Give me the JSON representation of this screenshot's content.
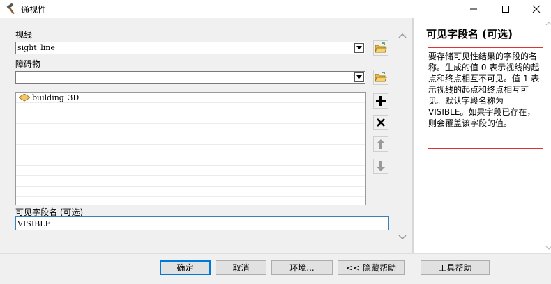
{
  "window": {
    "title": "通视性",
    "icon": "hammer-icon",
    "controls": {
      "minimize": "minimize-icon",
      "maximize": "maximize-icon",
      "close": "close-icon"
    }
  },
  "form": {
    "sight_line_label": "视线",
    "sight_line_value": "sight_line",
    "obstruction_label": "障碍物",
    "obstruction_value": "",
    "obstruction_list": [
      {
        "label": "building_3D",
        "icon": "polygon-layer-icon"
      }
    ],
    "visible_field_label": "可见字段名 (可选)",
    "visible_field_value": "VISIBLE"
  },
  "help": {
    "title": "可见字段名 (可选)",
    "body": "要存储可见性结果的字段的名称。生成的值 0 表示视线的起点和终点相互不可见。值 1 表示视线的起点和终点相互可见。默认字段名称为 VISIBLE。如果字段已存在，则会覆盖该字段的值。"
  },
  "buttons": {
    "ok": "确定",
    "cancel": "取消",
    "environments": "环境...",
    "hide_help": "<< 隐藏帮助",
    "tool_help": "工具帮助"
  },
  "colors": {
    "panel_bg": "#f0f0f0",
    "focus_border": "#3c7fb1",
    "help_highlight": "#dd3333",
    "primary_border": "#0078d7"
  }
}
